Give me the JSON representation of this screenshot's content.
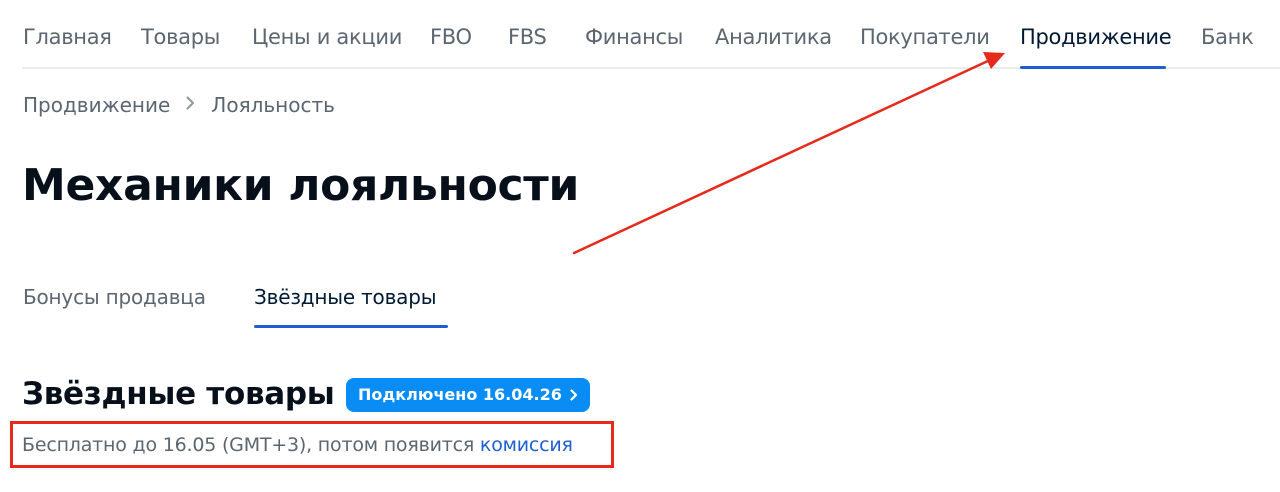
{
  "top_nav": {
    "items": [
      {
        "label": "Главная"
      },
      {
        "label": "Товары"
      },
      {
        "label": "Цены и акции"
      },
      {
        "label": "FBO"
      },
      {
        "label": "FBS"
      },
      {
        "label": "Финансы"
      },
      {
        "label": "Аналитика"
      },
      {
        "label": "Покупатели"
      },
      {
        "label": "Продвижение",
        "active": true
      },
      {
        "label": "Банк"
      }
    ]
  },
  "breadcrumb": {
    "parent": "Продвижение",
    "current": "Лояльность"
  },
  "page": {
    "title": "Механики лояльности"
  },
  "sub_tabs": {
    "items": [
      {
        "label": "Бонусы продавца"
      },
      {
        "label": "Звёздные товары",
        "active": true
      }
    ]
  },
  "section": {
    "title": "Звёздные товары",
    "badge": "Подключено 16.04.26",
    "info_text": "Бесплатно до 16.05 (GMT+3), потом появится ",
    "info_link": "комиссия"
  },
  "colors": {
    "accent": "#1f5fd1",
    "badge_bg": "#0a8cf5",
    "annotation": "#e52a1c",
    "text_primary": "#001a34",
    "text_secondary": "#5c6670"
  },
  "icons": {
    "breadcrumb_separator": "chevron-right-icon",
    "badge_chevron": "chevron-right-icon"
  }
}
